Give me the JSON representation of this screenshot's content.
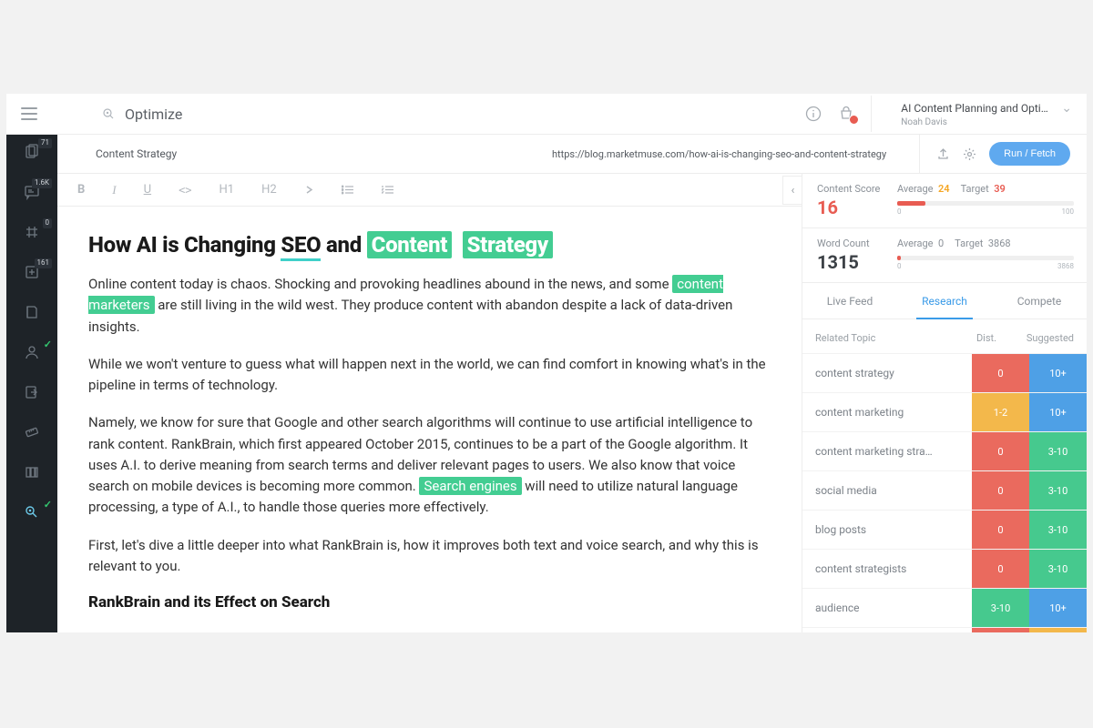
{
  "brand": {
    "name": "Optimize"
  },
  "project": {
    "title": "AI Content Planning and Optim…",
    "user": "Noah Davis"
  },
  "nav": {
    "badges": {
      "pages": "71",
      "comments": "1.6K",
      "tags": "0",
      "add": "161"
    }
  },
  "subheader": {
    "topic": "Content Strategy",
    "url": "https://blog.marketmuse.com/how-ai-is-changing-seo-and-content-strategy",
    "run_label": "Run / Fetch"
  },
  "toolbar": {
    "b": "B",
    "i": "I",
    "u": "U",
    "code": "<>",
    "h1": "H1",
    "h2": "H2"
  },
  "doc": {
    "title_pre": "How AI is Changing ",
    "title_seo": "SEO",
    "title_and": " and ",
    "title_content": "Content",
    "title_strategy": "Strategy",
    "p1a": "Online content today is chaos. Shocking and provoking headlines abound in the news, and some ",
    "p1hl1": "content marketers",
    "p1b": " are still living in the wild west. They produce content with abandon despite a lack of data-driven insights.",
    "p2": "While we won't venture to guess what will happen next in the world, we can find comfort in knowing what's in the pipeline in terms of technology.",
    "p3a": "Namely, we know for sure that Google and other search algorithms will continue to use artificial intelligence to rank content. RankBrain, which first appeared October 2015, continues to be a part of the Google algorithm. It uses A.I. to derive meaning from search terms and deliver relevant pages to users. We also know that voice search on mobile devices is becoming more common. ",
    "p3hl": "Search engines",
    "p3b": " will need to utilize natural language processing, a type of A.I., to handle those queries more effectively.",
    "p4": "First, let's dive a little deeper into what RankBrain is, how it improves both text and voice search, and why this is relevant to you.",
    "h2": "RankBrain and its Effect on Search"
  },
  "scores": {
    "content_score_label": "Content Score",
    "content_score": "16",
    "word_count_label": "Word Count",
    "word_count": "1315",
    "avg_label": "Average",
    "target_label": "Target",
    "cs_avg": "24",
    "cs_target": "39",
    "cs_min": "0",
    "cs_max": "100",
    "wc_avg": "0",
    "wc_target": "3868",
    "wc_min": "0",
    "wc_max": "3868"
  },
  "tabs": {
    "live": "Live Feed",
    "research": "Research",
    "compete": "Compete"
  },
  "topics": {
    "head_name": "Related Topic",
    "head_dist": "Dist.",
    "head_sugg": "Suggested",
    "rows": [
      {
        "name": "content strategy",
        "dist": "0",
        "dc": "c-red",
        "sugg": "10+",
        "sc": "c-blue"
      },
      {
        "name": "content marketing",
        "dist": "1-2",
        "dc": "c-yellow",
        "sugg": "10+",
        "sc": "c-blue"
      },
      {
        "name": "content marketing stra…",
        "dist": "0",
        "dc": "c-red",
        "sugg": "3-10",
        "sc": "c-green"
      },
      {
        "name": "social media",
        "dist": "0",
        "dc": "c-red",
        "sugg": "3-10",
        "sc": "c-green"
      },
      {
        "name": "blog posts",
        "dist": "0",
        "dc": "c-red",
        "sugg": "3-10",
        "sc": "c-green"
      },
      {
        "name": "content strategists",
        "dist": "0",
        "dc": "c-red",
        "sugg": "3-10",
        "sc": "c-green"
      },
      {
        "name": "audience",
        "dist": "3-10",
        "dc": "c-green",
        "sugg": "10+",
        "sc": "c-blue"
      },
      {
        "name": "",
        "dist": "",
        "dc": "c-red",
        "sugg": "",
        "sc": "c-yellow"
      }
    ]
  }
}
